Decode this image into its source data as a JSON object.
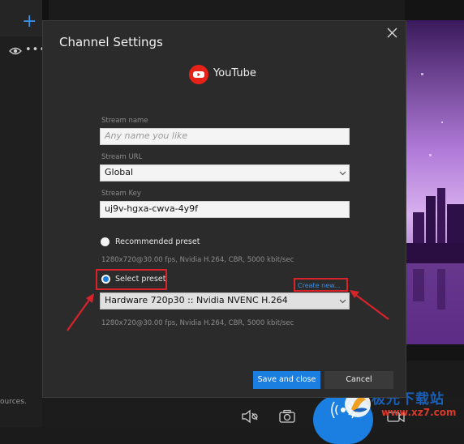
{
  "background": {
    "sources_text": "ources.",
    "add_icon": "plus-icon",
    "visibility_icon": "eye-icon",
    "more_icon": "more-dots-icon",
    "bottom_icons": [
      "mute-icon",
      "camera-icon",
      "broadcast-icon",
      "video-camera-icon"
    ]
  },
  "watermark": {
    "line1": "极光下载站",
    "line2": "www.xz7.com"
  },
  "dialog": {
    "title": "Channel Settings",
    "platform": "YouTube",
    "platform_icon": "youtube-logo-icon",
    "stream_name": {
      "label": "Stream name",
      "value": "",
      "placeholder": "Any name you like"
    },
    "stream_url": {
      "label": "Stream URL",
      "value": "Global"
    },
    "stream_key": {
      "label": "Stream Key",
      "value": "uj9v-hgxa-cwva-4y9f"
    },
    "recommended_preset": {
      "label": "Recommended preset",
      "selected": false,
      "info": "1280x720@30.00 fps, Nvidia H.264, CBR, 5000 kbit/sec"
    },
    "select_preset": {
      "label": "Select preset",
      "selected": true,
      "create_new": "Create new...",
      "value": "Hardware 720p30 :: Nvidia NVENC H.264",
      "info": "1280x720@30.00 fps, Nvidia H.264, CBR, 5000 kbit/sec"
    },
    "save_label": "Save and close",
    "cancel_label": "Cancel"
  },
  "colors": {
    "accent": "#1a7fe0",
    "highlight": "#d8232a",
    "youtube": "#e62117"
  }
}
